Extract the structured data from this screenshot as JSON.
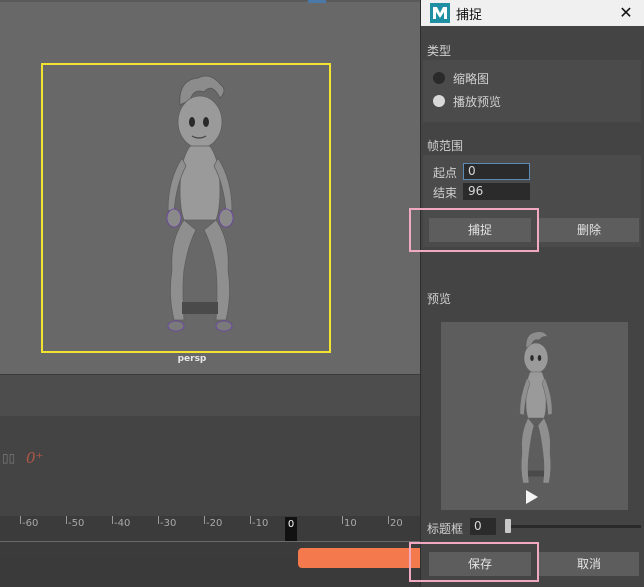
{
  "viewport": {
    "camera_label": "persp",
    "key_readout": "0⁺"
  },
  "timeline": {
    "tick_labels": [
      "-60",
      "-50",
      "-40",
      "-30",
      "-20",
      "-10",
      "",
      "10",
      "20"
    ],
    "current_frame": "0"
  },
  "dialog": {
    "title": "捕捉",
    "close_glyph": "✕",
    "type_section": {
      "label": "类型",
      "options": [
        {
          "label": "缩略图",
          "selected": false
        },
        {
          "label": "播放预览",
          "selected": true
        }
      ]
    },
    "frame_range": {
      "label": "帧范围",
      "start_label": "起点",
      "start_value": "0",
      "end_label": "结束",
      "end_value": "96"
    },
    "capture_button": "捕捉",
    "delete_button": "删除",
    "preview_label": "预览",
    "title_frame_label": "标题框",
    "title_frame_value": "0",
    "save_button": "保存",
    "cancel_button": "取消"
  },
  "colors": {
    "camera_frame": "#f2e330",
    "highlight": "#f0a9c0",
    "range_bar": "#f47a4d",
    "focus_border": "#5d8bb8"
  }
}
